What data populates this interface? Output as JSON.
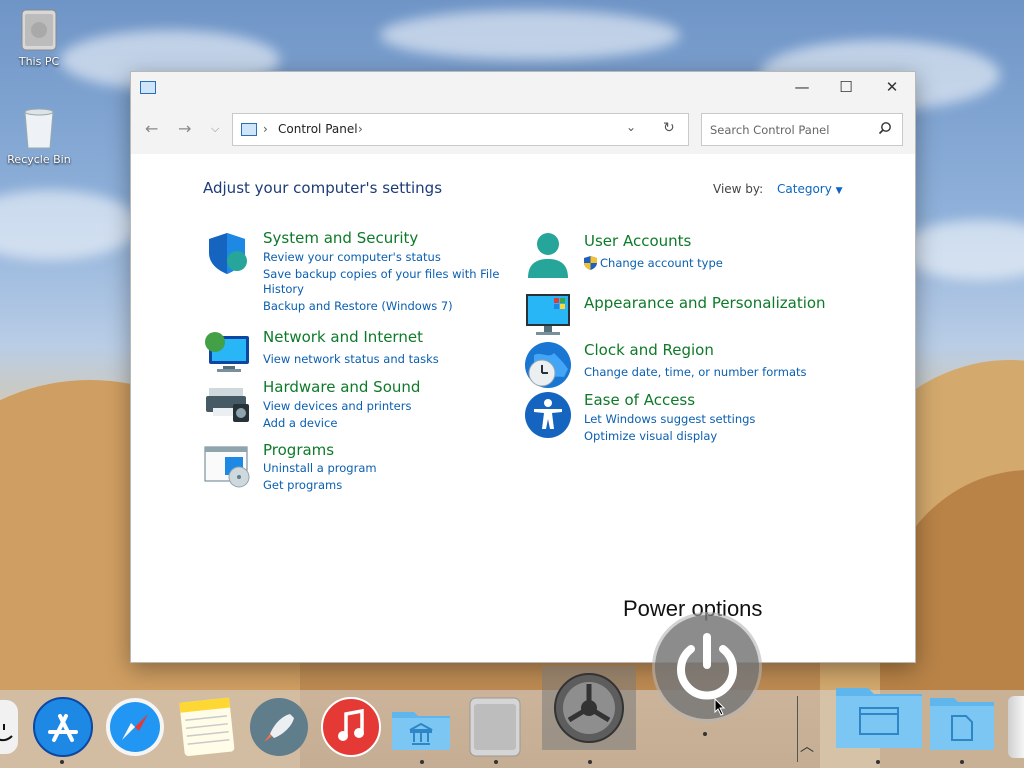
{
  "desktop": {
    "icons": [
      {
        "label": "This PC"
      },
      {
        "label": "Recycle Bin"
      }
    ]
  },
  "window": {
    "title_controls": {
      "minimize": "—",
      "maximize": "☐",
      "close": "✕"
    },
    "address": {
      "crumb": "Control Panel"
    },
    "search": {
      "placeholder": "Search Control Panel"
    },
    "heading": "Adjust your computer's settings",
    "view_by": {
      "label": "View by:",
      "value": "Category"
    },
    "categories": [
      {
        "title": "System and Security",
        "links": [
          "Review your computer's status",
          "Save backup copies of your files with File",
          "History",
          "Backup and Restore (Windows 7)"
        ]
      },
      {
        "title": "Network and Internet",
        "links": [
          "View network status and tasks"
        ]
      },
      {
        "title": "Hardware and Sound",
        "links": [
          "View devices and printers",
          "Add a device"
        ]
      },
      {
        "title": "Programs",
        "links": [
          "Uninstall a program",
          "Get programs"
        ]
      },
      {
        "title": "User Accounts",
        "links": [
          "Change account type"
        ]
      },
      {
        "title": "Appearance and Personalization",
        "links": []
      },
      {
        "title": "Clock and Region",
        "links": [
          "Change date, time, or number formats"
        ]
      },
      {
        "title": "Ease of Access",
        "links": [
          "Let Windows suggest settings",
          "Optimize visual display"
        ]
      }
    ]
  },
  "dock": {
    "power_label": "Power options",
    "icons": [
      "finder-icon",
      "app-store-icon",
      "safari-icon",
      "notes-icon",
      "launchpad-icon",
      "music-icon",
      "folder-icon",
      "mac-pro-icon",
      "system-preferences-icon",
      "power-icon",
      "folder-icon",
      "folder-icon"
    ]
  },
  "colors": {
    "link_blue": "#0a5fb2",
    "category_green": "#0d7a29",
    "heading_blue": "#1e3c78"
  }
}
